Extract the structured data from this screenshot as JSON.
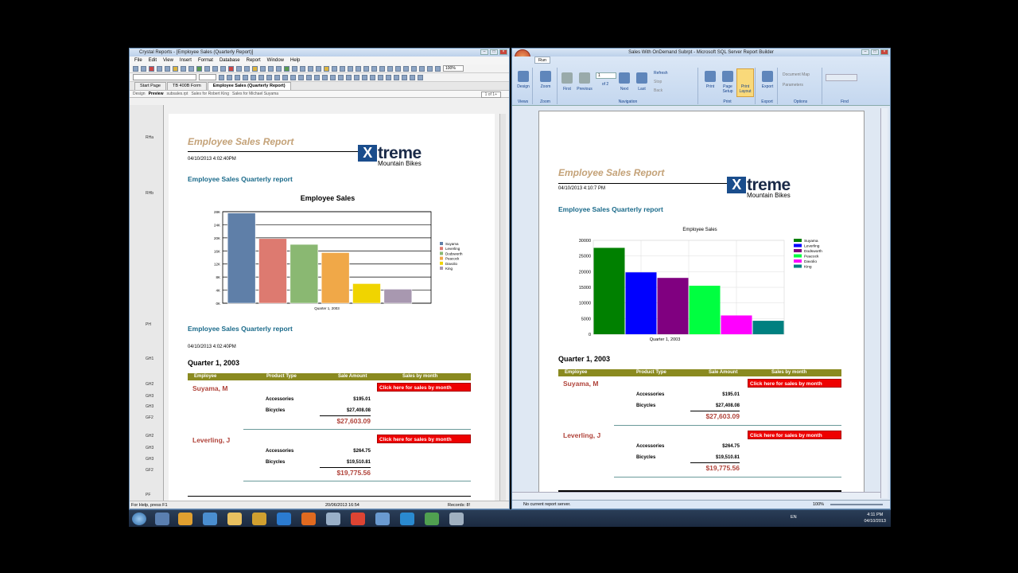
{
  "left_app": {
    "title": "Crystal Reports - [Employee Sales (Quarterly Report)]",
    "menu": [
      "File",
      "Edit",
      "View",
      "Insert",
      "Format",
      "Database",
      "Report",
      "Window",
      "Help"
    ],
    "zoom": "100%",
    "tabs": [
      "Start Page",
      "TB 400B Form",
      "Employee Sales (Quarterly Report)"
    ],
    "subtabs": [
      "Design",
      "Preview",
      "subsales.rpt",
      "Sales for Robert King",
      "Sales for Michael Suyama"
    ],
    "page_of": "1 of 1+",
    "sections": [
      "RHa",
      "RHb",
      "PH",
      "GH1",
      "GH2",
      "GH3",
      "GH3",
      "GF2",
      "GH2",
      "GH3",
      "GH3",
      "GF2",
      "PF"
    ],
    "status_help": "For Help, press F1",
    "status_date": "20/06/2013  16:54",
    "status_records": "Records: 8!"
  },
  "right_app": {
    "title": "Sales With OnDemand Subrpt - Microsoft SQL Server Report Builder",
    "ribbon_tab": "Run",
    "groups": [
      "Views",
      "Zoom",
      "Navigation",
      "Print",
      "Export",
      "Options",
      "Find"
    ],
    "buttons": {
      "design": "Design",
      "zoom": "Zoom",
      "first": "First",
      "previous": "Previous",
      "next": "Next",
      "last": "Last",
      "refresh": "Refresh",
      "stop": "Stop",
      "back": "Back",
      "print": "Print",
      "page_setup": "Page Setup",
      "print_layout": "Print Layout",
      "export": "Export",
      "document_map": "Document Map",
      "parameters": "Parameters"
    },
    "page_num": "1",
    "page_of": "of 2",
    "status": "No current report server.",
    "zoom": "100%"
  },
  "report_left": {
    "title": "Employee Sales Report",
    "datetime": "04/10/2013   4:02:40PM",
    "subtitle": "Employee Sales Quarterly report",
    "subtitle2": "Employee Sales Quarterly report",
    "datetime2": "04/10/2013   4:02:40PM",
    "quarter": "Quarter 1, 2003"
  },
  "report_right": {
    "title": "Employee Sales Report",
    "datetime": "04/10/2013   4:10:7 PM",
    "subtitle": "Employee Sales Quarterly report",
    "quarter": "Quarter 1, 2003"
  },
  "logo": {
    "brand": "treme",
    "x": "X",
    "tagline": "Mountain Bikes"
  },
  "table": {
    "headers": [
      "Employee",
      "Product Type",
      "Sale Amount",
      "Sales by month"
    ],
    "button_label": "Click here for sales by month",
    "groups": [
      {
        "name": "Suyama, M",
        "rows": [
          {
            "product": "Accessories",
            "amount": "$195.01"
          },
          {
            "product": "Bicycles",
            "amount": "$27,408.08"
          }
        ],
        "total": "$27,603.09"
      },
      {
        "name": "Leverling, J",
        "rows": [
          {
            "product": "Accessories",
            "amount": "$264.75"
          },
          {
            "product": "Bicycles",
            "amount": "$19,510.81"
          }
        ],
        "total": "$19,775.56"
      }
    ]
  },
  "taskbar": {
    "lang": "EN",
    "time": "4:11 PM",
    "date": "04/10/2013"
  },
  "chart_data": [
    {
      "type": "bar",
      "title": "Employee Sales",
      "xlabel": "Quarter 1, 2003",
      "categories": [
        "Suyama",
        "Leverling",
        "Dodsworth",
        "Peacock",
        "Davolio",
        "King"
      ],
      "values": [
        27603.09,
        19775.56,
        18000,
        15500,
        6000,
        4300
      ],
      "colors": [
        "#5f7fa8",
        "#dd7a70",
        "#8ab872",
        "#f0a848",
        "#f0d400",
        "#a898b0"
      ],
      "yticks": [
        "0K",
        "4K",
        "8K",
        "12K",
        "16K",
        "20K",
        "24K",
        "28K"
      ],
      "ylim": [
        0,
        28000
      ],
      "legend": "right"
    },
    {
      "type": "bar",
      "title": "Employee Sales",
      "xlabel": "Quarter 1, 2003",
      "categories": [
        "Suyama",
        "Leverling",
        "Dodsworth",
        "Peacock",
        "Davolio",
        "King"
      ],
      "values": [
        27603.09,
        19775.56,
        18000,
        15500,
        6000,
        4300
      ],
      "colors": [
        "#008000",
        "#0000ff",
        "#800080",
        "#00ff40",
        "#ff00ff",
        "#008080"
      ],
      "yticks": [
        "0",
        "5000",
        "10000",
        "15000",
        "20000",
        "25000",
        "30000"
      ],
      "ylim": [
        0,
        30000
      ],
      "grid": true,
      "legend": "right"
    }
  ]
}
